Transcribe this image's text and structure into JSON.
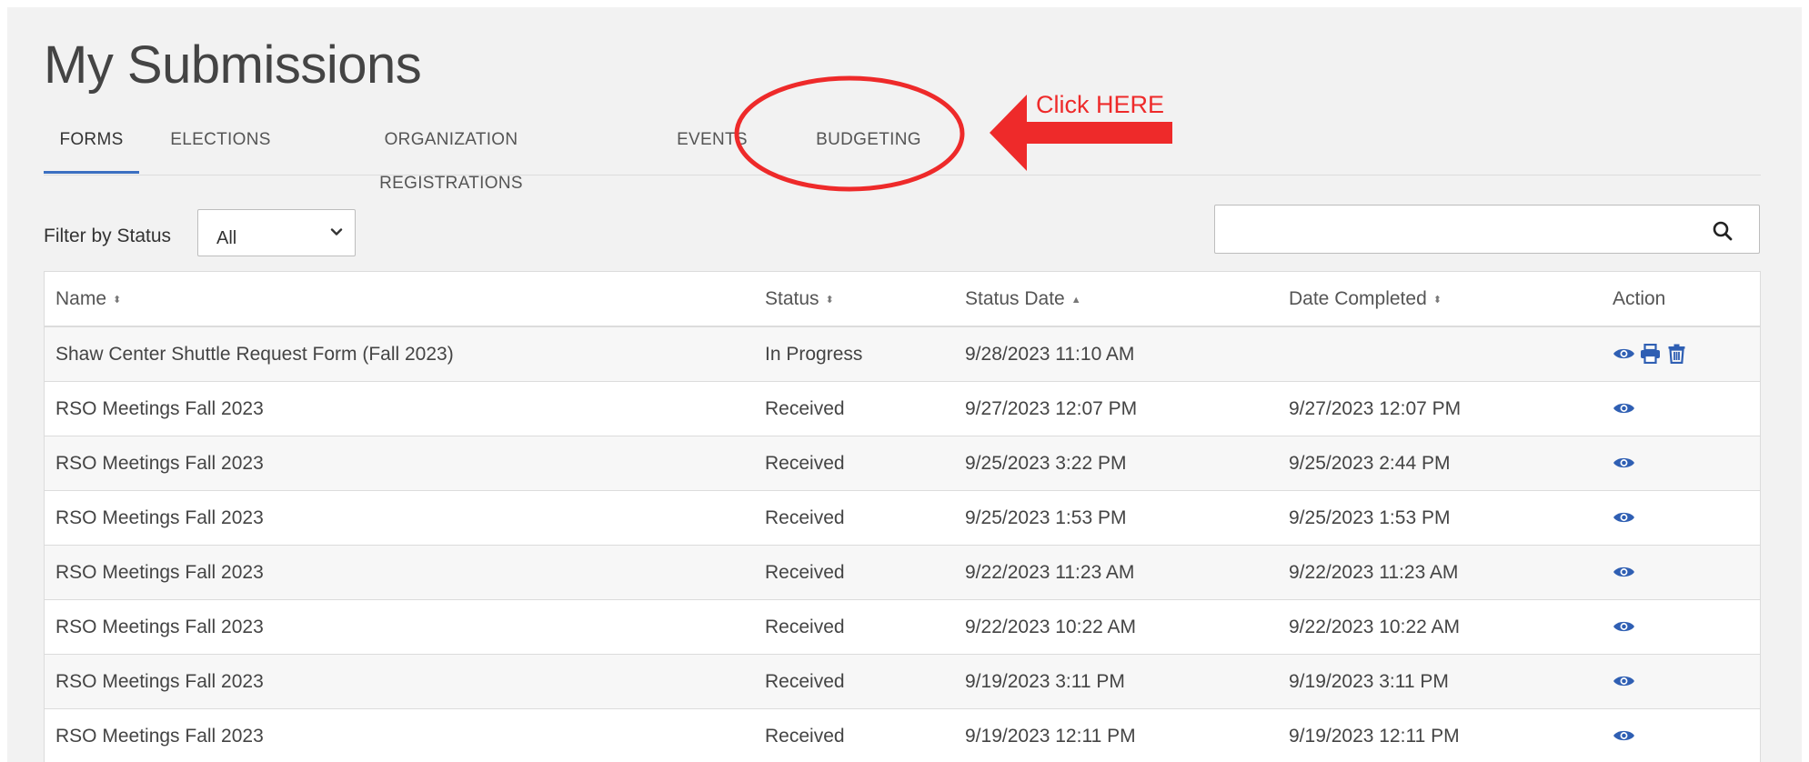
{
  "page": {
    "title": "My Submissions"
  },
  "tabs": [
    {
      "label": "FORMS",
      "active": true
    },
    {
      "label": "ELECTIONS",
      "active": false
    },
    {
      "label": "ORGANIZATION REGISTRATIONS",
      "active": false
    },
    {
      "label": "EVENTS",
      "active": false
    },
    {
      "label": "BUDGETING",
      "active": false
    }
  ],
  "filter": {
    "label": "Filter by Status",
    "selected": "All"
  },
  "search": {
    "value": "",
    "icon": "search-icon"
  },
  "table": {
    "columns": [
      "Name",
      "Status",
      "Status Date",
      "Date Completed",
      "Action"
    ],
    "rows": [
      {
        "name": "Shaw Center Shuttle Request Form (Fall 2023)",
        "status": "In Progress",
        "status_date": "9/28/2023 11:10 AM",
        "date_completed": "",
        "actions": [
          "view-icon",
          "print-icon",
          "trash-icon"
        ]
      },
      {
        "name": "RSO Meetings Fall 2023",
        "status": "Received",
        "status_date": "9/27/2023 12:07 PM",
        "date_completed": "9/27/2023 12:07 PM",
        "actions": [
          "view-icon"
        ]
      },
      {
        "name": "RSO Meetings Fall 2023",
        "status": "Received",
        "status_date": "9/25/2023 3:22 PM",
        "date_completed": "9/25/2023 2:44 PM",
        "actions": [
          "view-icon"
        ]
      },
      {
        "name": "RSO Meetings Fall 2023",
        "status": "Received",
        "status_date": "9/25/2023 1:53 PM",
        "date_completed": "9/25/2023 1:53 PM",
        "actions": [
          "view-icon"
        ]
      },
      {
        "name": "RSO Meetings Fall 2023",
        "status": "Received",
        "status_date": "9/22/2023 11:23 AM",
        "date_completed": "9/22/2023 11:23 AM",
        "actions": [
          "view-icon"
        ]
      },
      {
        "name": "RSO Meetings Fall 2023",
        "status": "Received",
        "status_date": "9/22/2023 10:22 AM",
        "date_completed": "9/22/2023 10:22 AM",
        "actions": [
          "view-icon"
        ]
      },
      {
        "name": "RSO Meetings Fall 2023",
        "status": "Received",
        "status_date": "9/19/2023 3:11 PM",
        "date_completed": "9/19/2023 3:11 PM",
        "actions": [
          "view-icon"
        ]
      },
      {
        "name": "RSO Meetings Fall 2023",
        "status": "Received",
        "status_date": "9/19/2023 12:11 PM",
        "date_completed": "9/19/2023 12:11 PM",
        "actions": [
          "view-icon"
        ]
      }
    ]
  },
  "annotation": {
    "text": "Click HERE",
    "color": "#ee2a2a"
  },
  "colors": {
    "accent": "#3b6fc1",
    "icon": "#2f5fb3",
    "annotation": "#ee2a2a"
  }
}
